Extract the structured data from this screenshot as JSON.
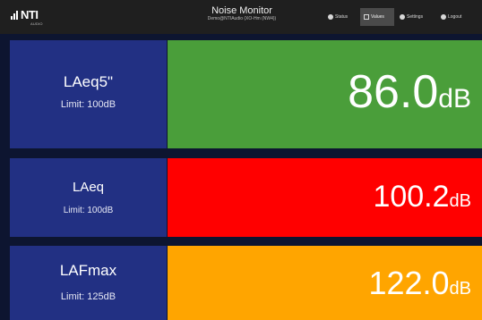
{
  "header": {
    "logo_text": "NTI",
    "logo_subtext": "AUDIO",
    "title": "Noise Monitor",
    "subtitle": "Demo@NTIAudio (XO-Hm (NW4))",
    "nav": [
      {
        "label": "Status",
        "icon": "status-icon",
        "active": false
      },
      {
        "label": "Values",
        "icon": "grid-icon",
        "active": true
      },
      {
        "label": "Settings",
        "icon": "gear-icon",
        "active": false
      },
      {
        "label": "Logout",
        "icon": "power-icon",
        "active": false
      }
    ]
  },
  "metrics": [
    {
      "name": "LAeq5\"",
      "limit": "Limit: 100dB",
      "value": "86.0",
      "unit": "dB",
      "status_color": "#4a9e3a"
    },
    {
      "name": "LAeq",
      "limit": "Limit: 100dB",
      "value": "100.2",
      "unit": "dB",
      "status_color": "#ff0000"
    },
    {
      "name": "LAFmax",
      "limit": "Limit: 125dB",
      "value": "122.0",
      "unit": "dB",
      "status_color": "#ffa500"
    }
  ],
  "colors": {
    "label_bg": "#223083",
    "page_bg": "#0d1530",
    "header_bg": "#1f1f1f"
  }
}
